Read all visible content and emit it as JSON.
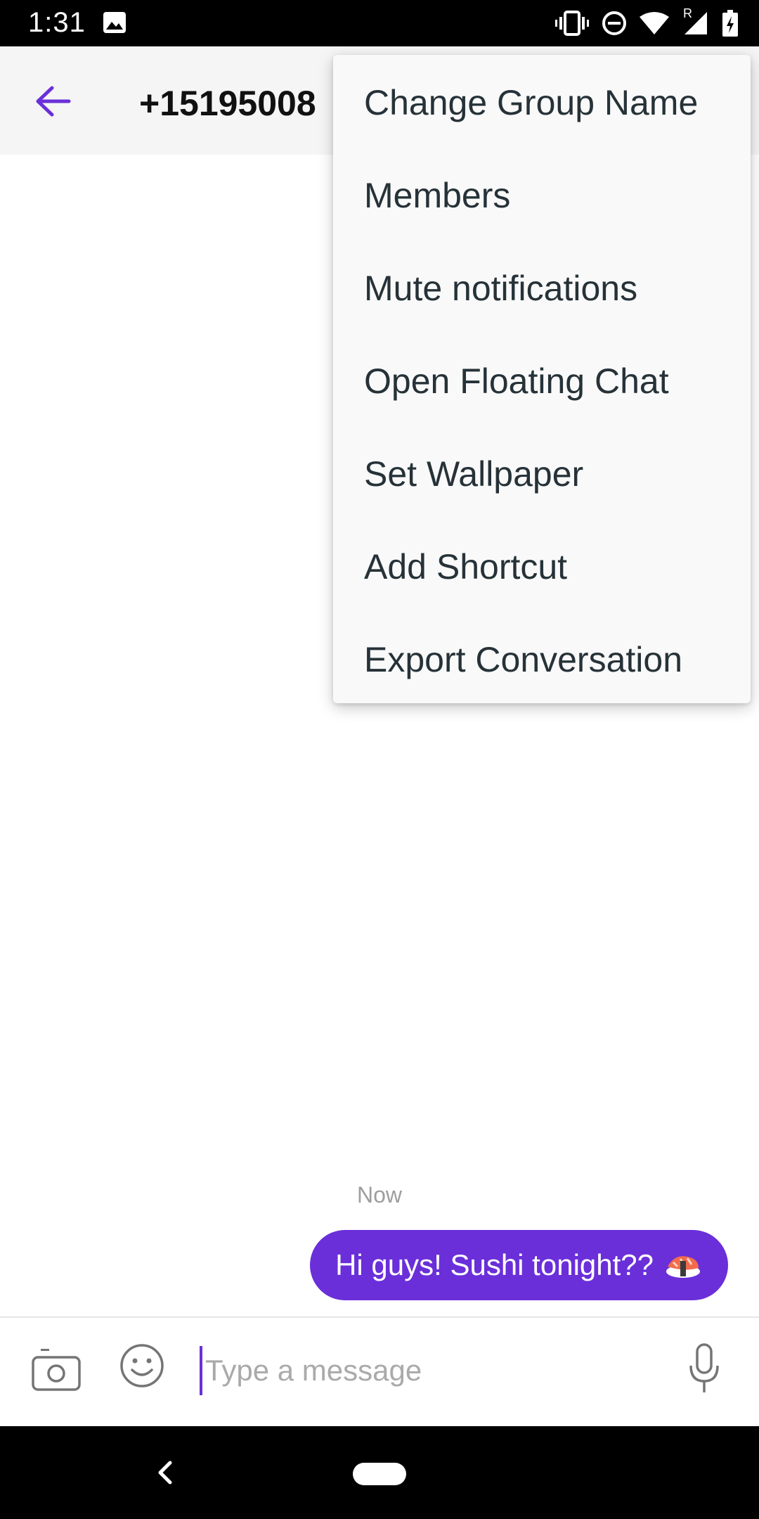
{
  "status_bar": {
    "time": "1:31",
    "network_badge": "R"
  },
  "toolbar": {
    "title": "+15195008"
  },
  "menu": {
    "items": [
      "Change Group Name",
      "Members",
      "Mute notifications",
      "Open Floating Chat",
      "Set Wallpaper",
      "Add Shortcut",
      "Export Conversation"
    ]
  },
  "chat": {
    "timestamp": "Now",
    "messages": [
      {
        "text": "Hi guys! Sushi tonight??",
        "emoji_icon": "sushi-icon"
      }
    ]
  },
  "composer": {
    "placeholder": "Type a message"
  },
  "colors": {
    "accent": "#6a2fd9",
    "toolbar_bg": "#f5f5f5",
    "menu_bg": "#f9f9f9"
  }
}
